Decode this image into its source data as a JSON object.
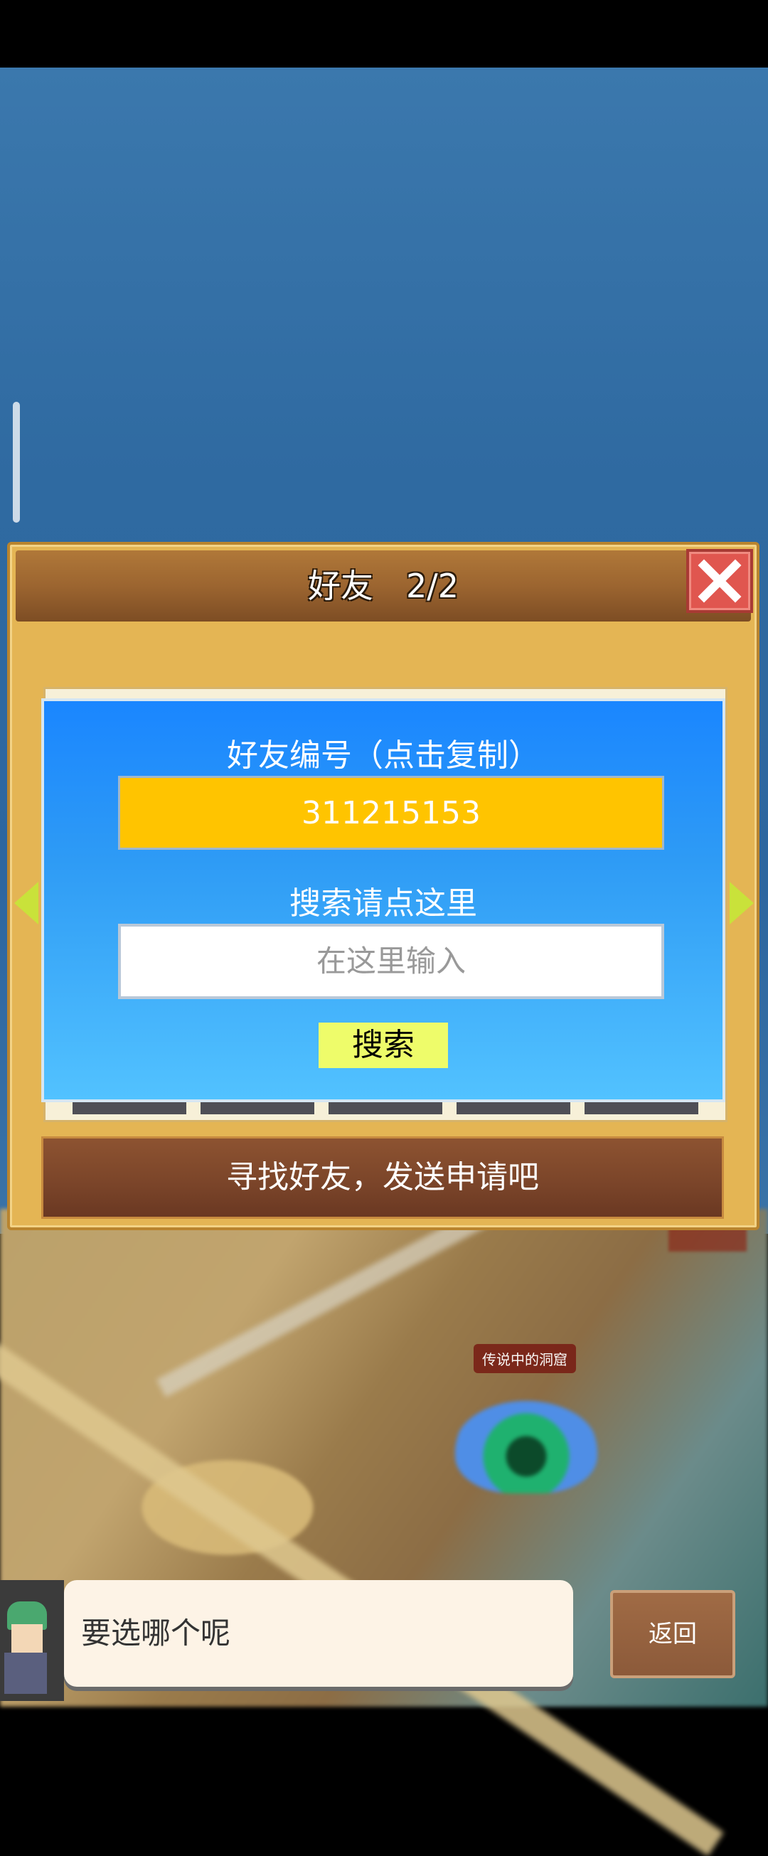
{
  "panel": {
    "title": "好友　2/2",
    "close_icon": "close-icon"
  },
  "friend_card": {
    "id_label": "好友编号（点击复制）",
    "friend_id": "311215153",
    "search_label": "搜索请点这里",
    "search_placeholder": "在这里输入",
    "search_button": "搜索"
  },
  "find_bar": {
    "text": "寻找好友，发送申请吧"
  },
  "map": {
    "cave_label": "传说中的洞窟"
  },
  "dialog": {
    "text": "要选哪个呢"
  },
  "back_button": {
    "label": "返回"
  },
  "colors": {
    "panel": "#e4b554",
    "card_top": "#1a86ff",
    "card_bottom": "#52c2ff",
    "id_box": "#ffc400",
    "search_button": "#eefc6a",
    "close": "#e0564f"
  }
}
